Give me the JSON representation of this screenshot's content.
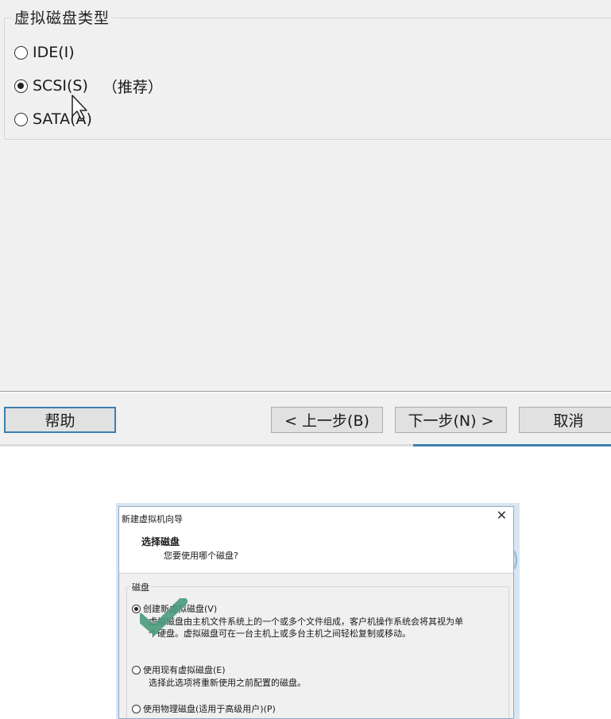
{
  "top_panel": {
    "group_title": "虚拟磁盘类型",
    "options": [
      {
        "label": "IDE(I)",
        "selected": false
      },
      {
        "label": "SCSI(S)",
        "selected": true,
        "note": "（推荐）"
      },
      {
        "label": "SATA(A)",
        "selected": false
      }
    ],
    "buttons": {
      "help": "帮助",
      "back": "< 上一步(B)",
      "next": "下一步(N) >",
      "cancel": "取消"
    }
  },
  "dialog": {
    "title": "新建虚拟机向导",
    "close_glyph": "✕",
    "heading": "选择磁盘",
    "subheading": "您要使用哪个磁盘?",
    "group_label": "磁盘",
    "options": [
      {
        "label": "创建新虚拟磁盘(V)",
        "selected": true,
        "desc_line1": "虚拟磁盘由主机文件系统上的一个或多个文件组成，客户机操作系统会将其视为单",
        "desc_line2": "个硬盘。虚拟磁盘可在一台主机上或多台主机之间轻松复制或移动。"
      },
      {
        "label": "使用现有虚拟磁盘(E)",
        "selected": false,
        "desc_line1": "选择此选项将重新使用之前配置的磁盘。"
      },
      {
        "label": "使用物理磁盘(适用于高级用户)(P)",
        "selected": false
      }
    ]
  },
  "colors": {
    "panel_bg": "#f0f0f0",
    "focus_border": "#3c7fb1",
    "check_mark": "#4a9a7c"
  }
}
